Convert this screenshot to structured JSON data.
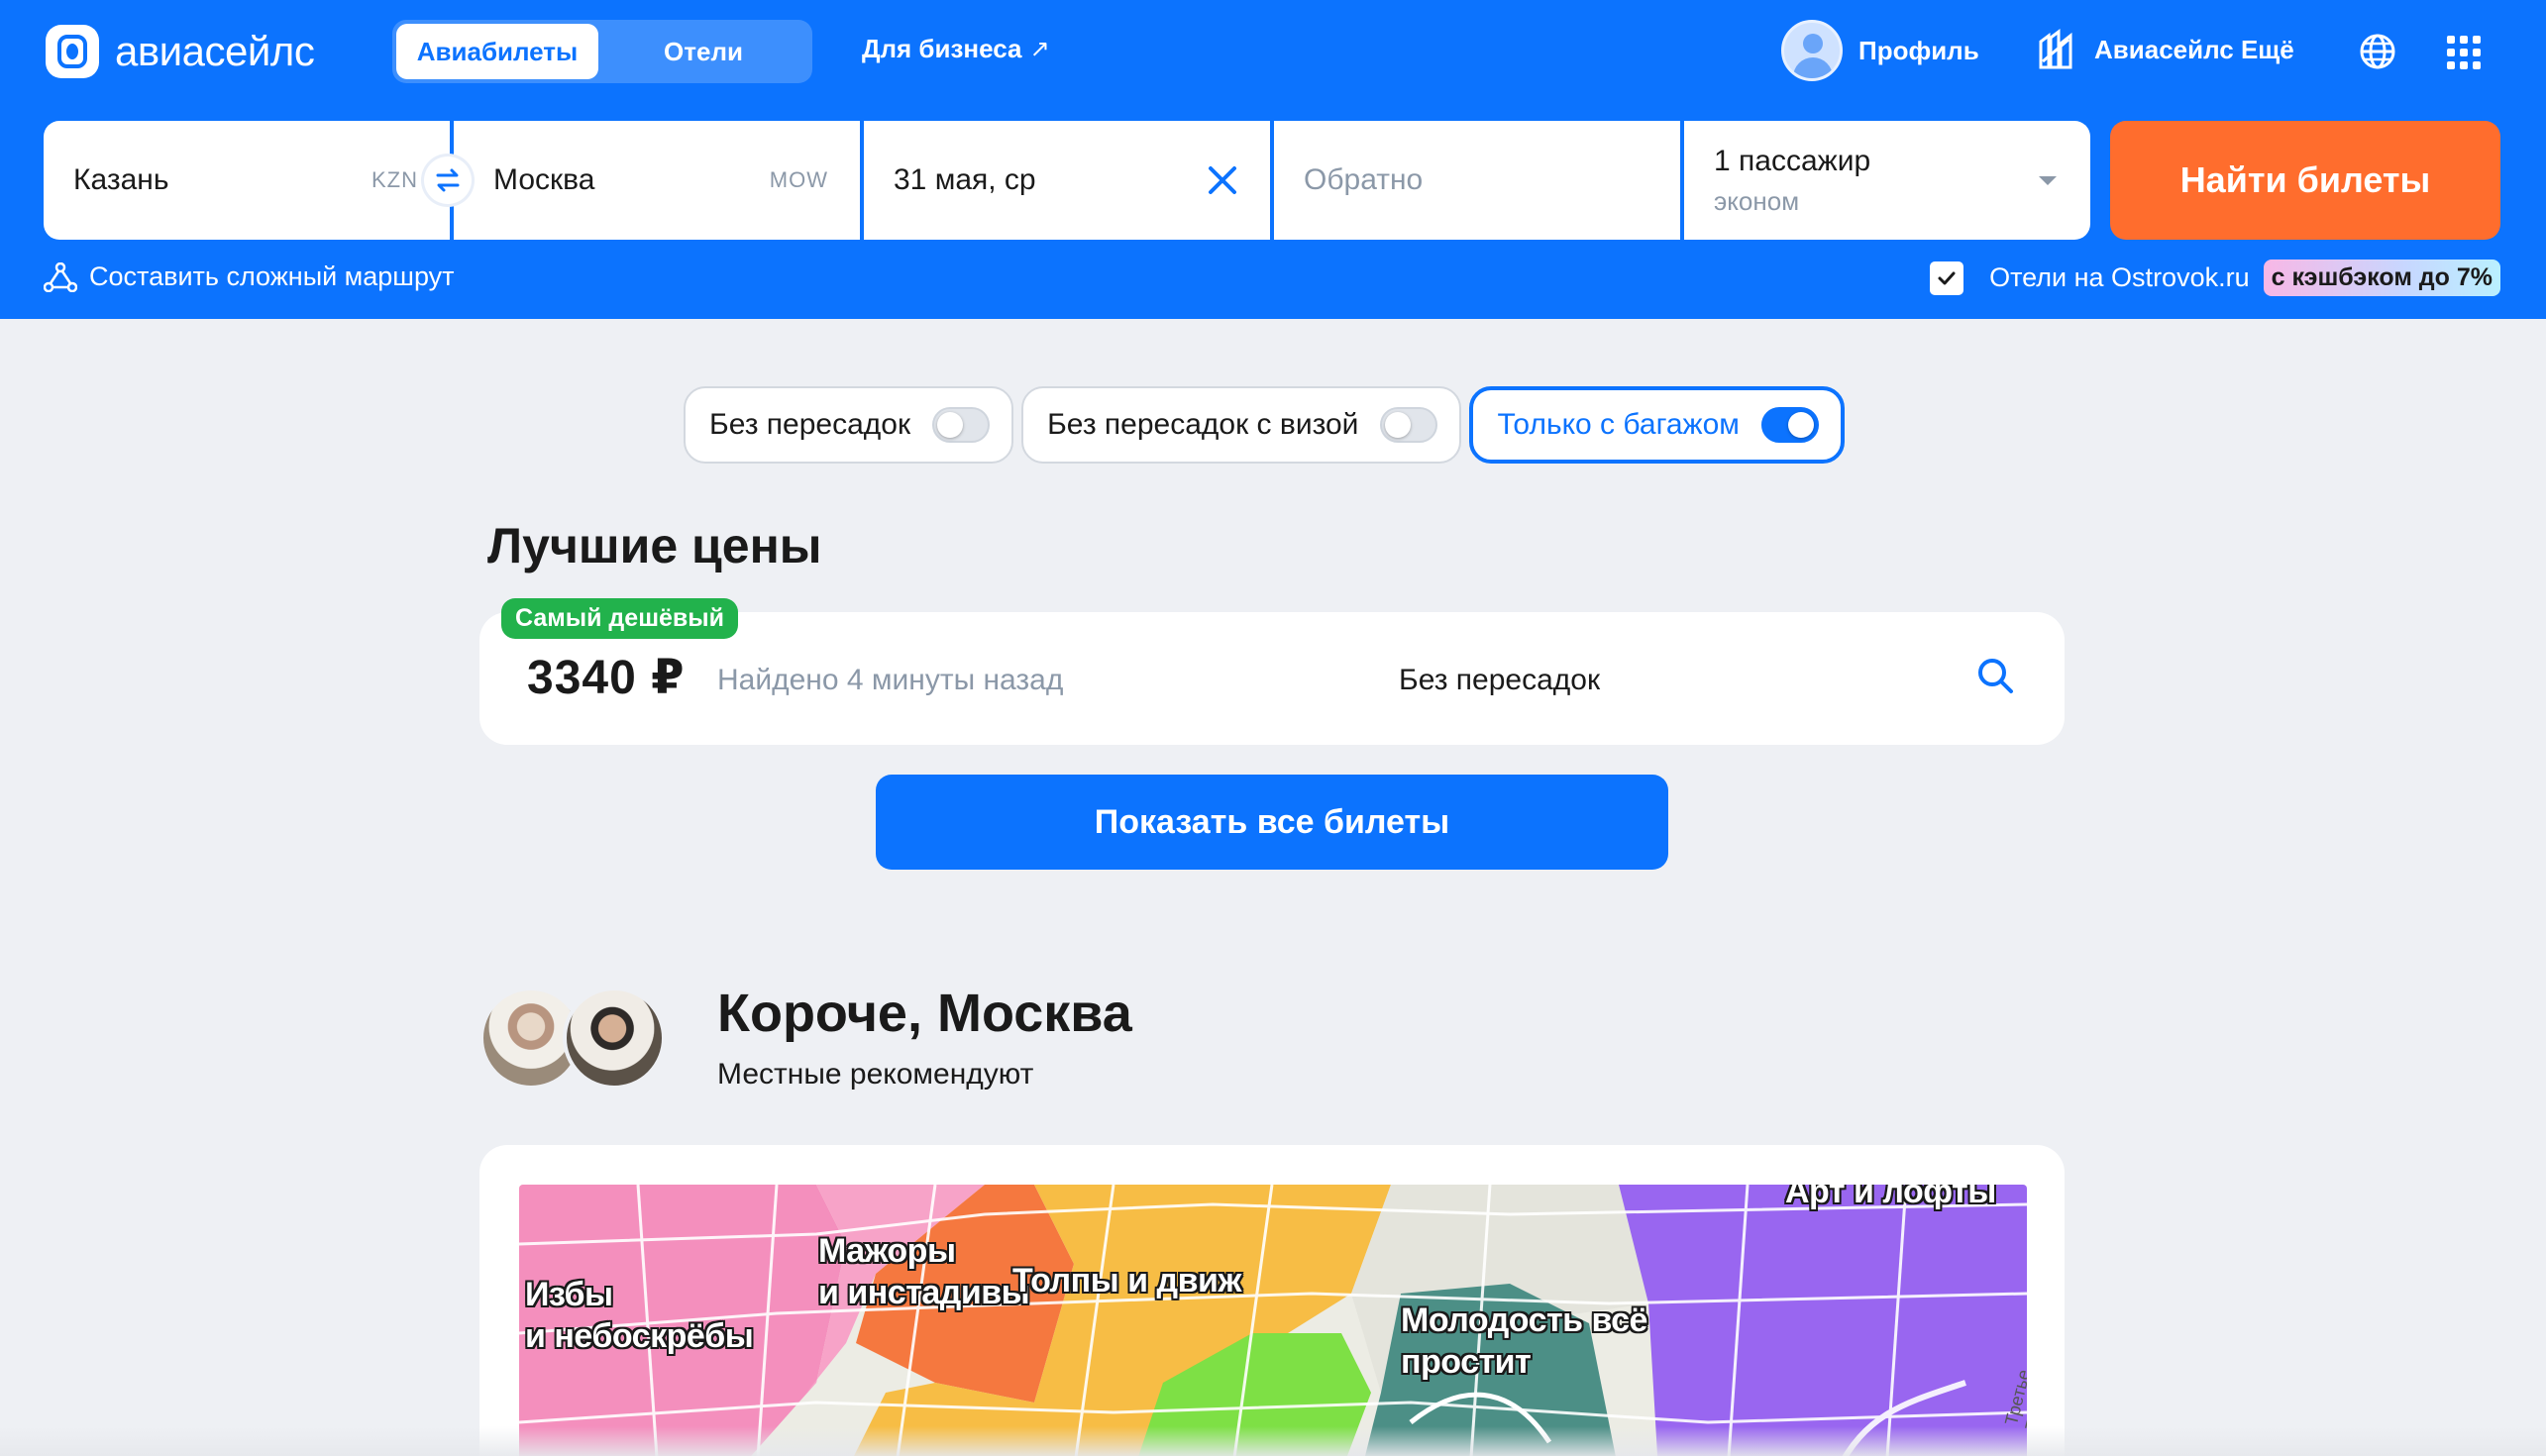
{
  "header": {
    "logo_text": "авиасейлс",
    "tabs": [
      {
        "label": "Авиабилеты",
        "active": true
      },
      {
        "label": "Отели",
        "active": false
      }
    ],
    "business_link": "Для бизнеса",
    "profile_label": "Профиль",
    "more_label": "Авиасейлс Ещё",
    "icons": [
      "logo-icon",
      "person-icon",
      "aviasales-more-icon",
      "globe-icon",
      "apps-grid-icon"
    ],
    "brand_color": "#0c73fe"
  },
  "search": {
    "origin": {
      "city": "Казань",
      "code": "KZN"
    },
    "destination": {
      "city": "Москва",
      "code": "MOW"
    },
    "depart_date": "31 мая, ср",
    "return_placeholder": "Обратно",
    "passengers": "1 пассажир",
    "cabin_class": "эконом",
    "submit_label": "Найти билеты",
    "submit_color": "#ff6d2d",
    "complex_route_label": "Составить сложный маршрут",
    "hotels_checkbox": {
      "label": "Отели на Ostrovok.ru",
      "checked": true,
      "badge": "с кэшбэком до 7%"
    }
  },
  "filters": [
    {
      "label": "Без пересадок",
      "on": false
    },
    {
      "label": "Без пересадок с визой",
      "on": false
    },
    {
      "label": "Только с багажом",
      "on": true
    }
  ],
  "best_prices": {
    "title": "Лучшие цены",
    "badge": "Самый дешёвый",
    "price": "3340 ₽",
    "found": "Найдено 4 минуты назад",
    "stops": "Без пересадок",
    "show_all_label": "Показать все билеты"
  },
  "koroche": {
    "title": "Короче, Москва",
    "subtitle": "Местные рекомендуют",
    "map_labels": [
      {
        "text": "Избы\nи небоскрёбы"
      },
      {
        "text": "Мажоры\nи инстадивы"
      },
      {
        "text": "Толпы и движ"
      },
      {
        "text": "Молодость всё\nпростит"
      },
      {
        "text": "Арт и лофты"
      }
    ],
    "street_label": "Третье Транспо..."
  }
}
